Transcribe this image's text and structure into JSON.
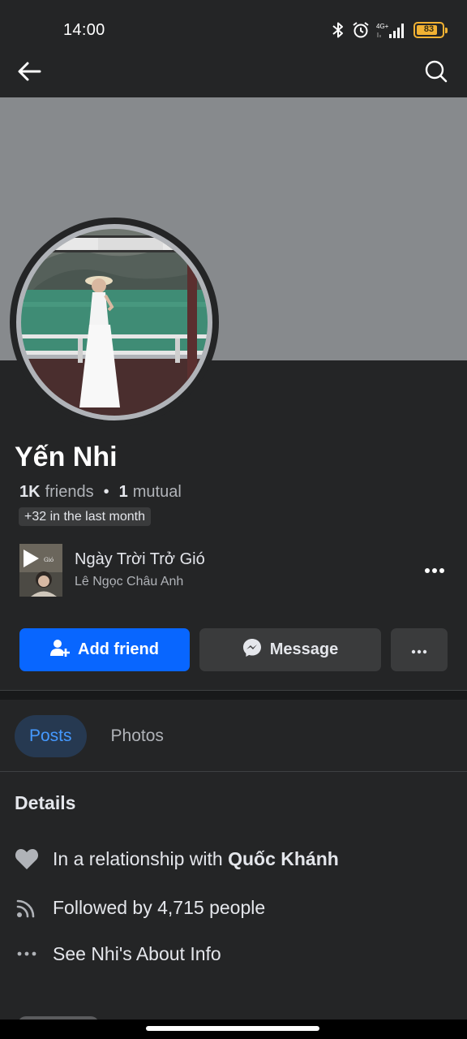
{
  "status_bar": {
    "time": "14:00",
    "network": "4G+",
    "battery_level": "83",
    "battery_fraction": 0.83,
    "icons": [
      "bluetooth-icon",
      "alarm-icon",
      "signal-icon",
      "battery-icon"
    ]
  },
  "nav": {
    "back_icon": "arrow-left-icon",
    "search_icon": "search-icon"
  },
  "profile": {
    "name": "Yến Nhi",
    "friends_count": "1K",
    "friends_label": "friends",
    "mutual_count": "1",
    "mutual_label": "mutual",
    "growth": "+32 in the last month"
  },
  "music": {
    "title": "Ngày Trời Trở Gió",
    "artist": "Lê Ngọc Châu Anh"
  },
  "actions": {
    "add_friend": "Add friend",
    "message": "Message"
  },
  "tabs": [
    {
      "label": "Posts",
      "active": true
    },
    {
      "label": "Photos",
      "active": false
    }
  ],
  "details": {
    "title": "Details",
    "relationship_prefix": "In a relationship with",
    "relationship_partner": "Quốc Khánh",
    "followed_by": "Followed by 4,715 people",
    "about_link": "See Nhi's About Info"
  },
  "colors": {
    "background": "#242526",
    "accent": "#0866ff",
    "tab_active_bg": "#263951",
    "tab_active_text": "#4599ff",
    "battery": "#f2b233"
  }
}
